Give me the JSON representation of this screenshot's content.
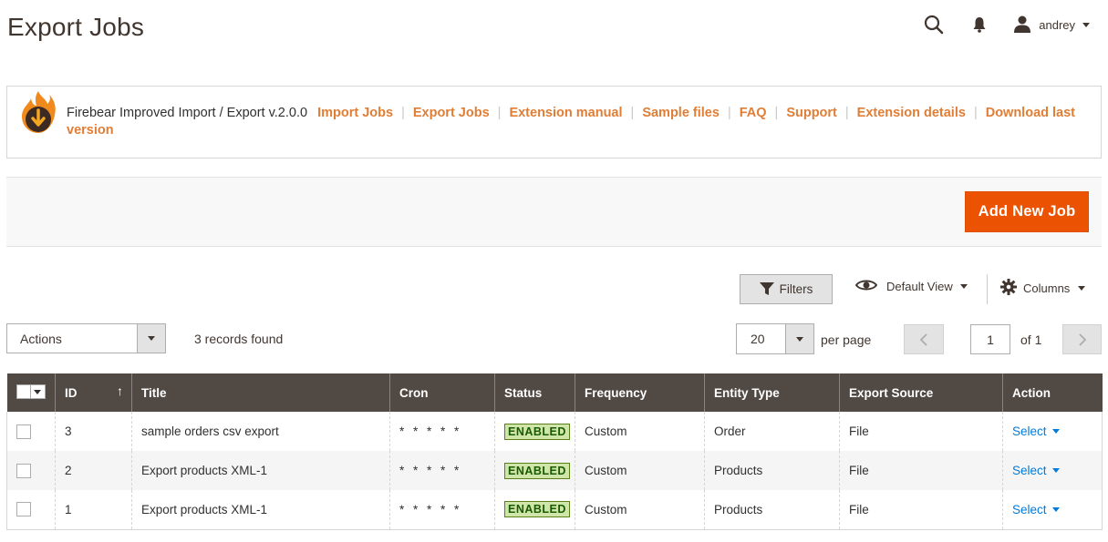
{
  "page": {
    "title": "Export Jobs"
  },
  "header": {
    "user_name": "andrey",
    "search_icon": "search-icon",
    "bell_icon": "bell-icon",
    "user_icon": "user-icon"
  },
  "extension": {
    "version_text": "Firebear Improved Import / Export v.2.0.0",
    "links": [
      "Import Jobs",
      "Export Jobs",
      "Extension manual",
      "Sample files",
      "FAQ",
      "Support",
      "Extension details",
      "Download last version"
    ],
    "link_color": "#e07e36"
  },
  "toolbar": {
    "add_button": "Add New Job",
    "accent": "#eb5202"
  },
  "grid_controls": {
    "filters_label": "Filters",
    "view_label": "Default View",
    "columns_label": "Columns",
    "actions_label": "Actions",
    "records_text": "3 records found",
    "per_page_value": "20",
    "per_page_label": "per page",
    "current_page": "1",
    "of_pages": "of 1"
  },
  "table": {
    "columns": [
      "ID",
      "Title",
      "Cron",
      "Status",
      "Frequency",
      "Entity Type",
      "Export Source",
      "Action"
    ],
    "sort_indicator": "↑",
    "rows": [
      {
        "id": "3",
        "title": "sample orders csv export",
        "cron": "* * * * *",
        "status": "ENABLED",
        "frequency": "Custom",
        "entity": "Order",
        "source": "File",
        "action": "Select"
      },
      {
        "id": "2",
        "title": "Export products XML-1",
        "cron": "* * * * *",
        "status": "ENABLED",
        "frequency": "Custom",
        "entity": "Products",
        "source": "File",
        "action": "Select"
      },
      {
        "id": "1",
        "title": "Export products XML-1",
        "cron": "* * * * *",
        "status": "ENABLED",
        "frequency": "Custom",
        "entity": "Products",
        "source": "File",
        "action": "Select"
      }
    ],
    "header_bg": "#514943"
  }
}
